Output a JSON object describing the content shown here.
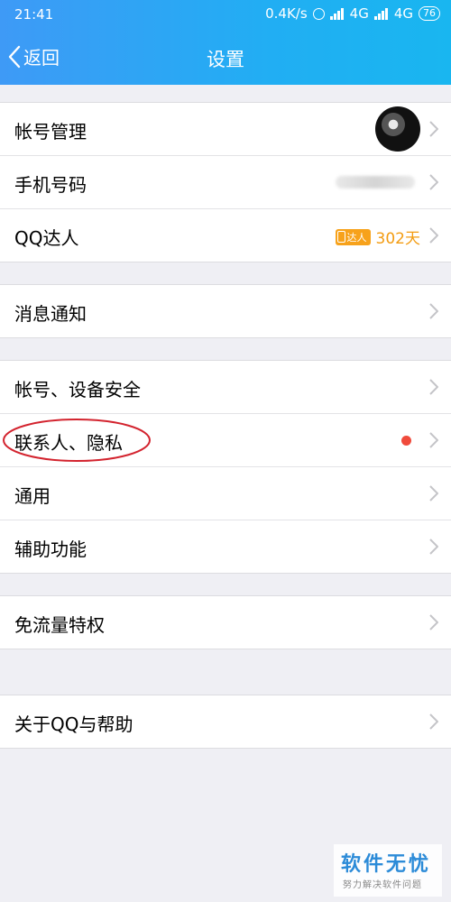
{
  "status_bar": {
    "time": "21:41",
    "speed": "0.4K/s",
    "network1": "4G",
    "network2": "4G",
    "battery": "76"
  },
  "navbar": {
    "back_label": "返回",
    "title": "设置"
  },
  "groups": [
    {
      "items": [
        {
          "label": "帐号管理",
          "has_avatar": true
        },
        {
          "label": "手机号码",
          "value_masked": true
        },
        {
          "label": "QQ达人",
          "badge_text": "达人",
          "days": "302天"
        }
      ]
    },
    {
      "items": [
        {
          "label": "消息通知"
        }
      ]
    },
    {
      "items": [
        {
          "label": "帐号、设备安全"
        },
        {
          "label": "联系人、隐私",
          "red_dot": true,
          "highlighted": true
        },
        {
          "label": "通用"
        },
        {
          "label": "辅助功能"
        }
      ]
    },
    {
      "items": [
        {
          "label": "免流量特权"
        }
      ]
    },
    {
      "items": [
        {
          "label": "关于QQ与帮助"
        }
      ]
    }
  ],
  "watermark": {
    "main": "软件无忧",
    "sub": "努力解决软件问题"
  },
  "colors": {
    "header_start": "#3e9af6",
    "header_end": "#19b6f0",
    "daren_orange": "#f39c12",
    "red_dot": "#f04b3c",
    "annotation_circle": "#d3232e"
  }
}
